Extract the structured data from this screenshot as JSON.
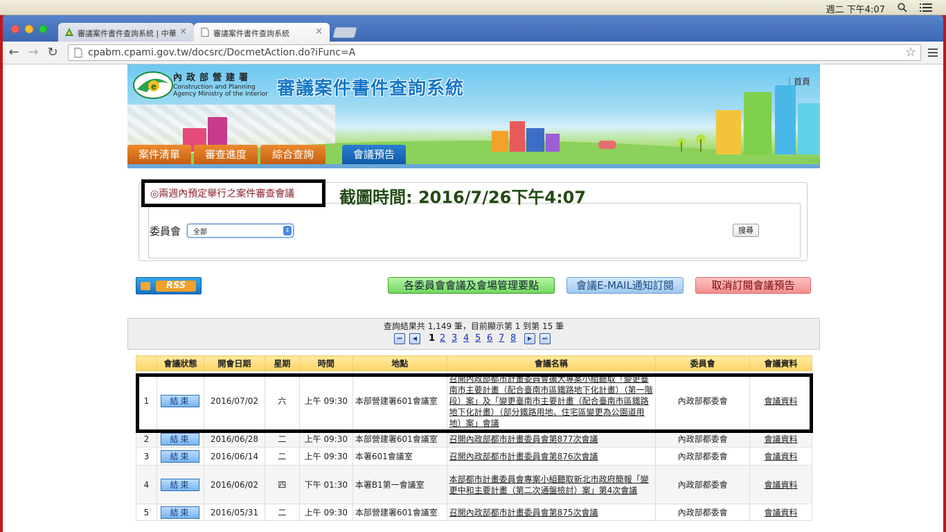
{
  "menubar": {
    "clock": "週二 下午4:07"
  },
  "browser": {
    "tabs": [
      {
        "title": "審議案件書件查詢系統 | 中華"
      },
      {
        "title": "審議案件書件查詢系統"
      }
    ],
    "url": "cpabm.cpami.gov.tw/docsrc/DocmetAction.do?iFunc=A",
    "accent": "#4d7ac3"
  },
  "site": {
    "agency_zh": "內政部營建署",
    "agency_en1": "Construction and Planning",
    "agency_en2": "Agency Ministry of the Interior",
    "system_title": "審議案件書件查詢系統",
    "home_link": "｜首頁",
    "nav": [
      "案件清單",
      "審查進度",
      "綜合查詢",
      "會議預告"
    ]
  },
  "notice": {
    "heading": "◎兩週內預定舉行之案件審查會議",
    "capture_time": "截圖時間: 2016/7/26下午4:07"
  },
  "filter": {
    "label": "委員會",
    "selected": "全部",
    "search_button": "搜尋"
  },
  "actions": {
    "rss": "RSS",
    "rules": "各委員會會議及會場管理要點",
    "subscribe": "會議E-MAIL通知訂閱",
    "unsubscribe": "取消訂閱會議預告"
  },
  "results": {
    "summary": "查詢結果共 1,149 筆，目前顯示第 1 到第 15 筆",
    "pages": [
      "1",
      "2",
      "3",
      "4",
      "5",
      "6",
      "7",
      "8"
    ],
    "current_page": "1"
  },
  "table": {
    "headers": [
      "",
      "會議狀態",
      "開會日期",
      "星期",
      "時間",
      "地點",
      "會議名稱",
      "委員會",
      "會議資料"
    ],
    "rows": [
      {
        "no": "1",
        "status": "結束",
        "date": "2016/07/02",
        "weekday": "六",
        "time": "上午 09:30",
        "place": "本部營建署601會議室",
        "name": "召開內政部都市計畫委員會擴大專案小組聽取「變更臺南市主要計畫（配合臺南市區鐵路地下化計畫）（第一階段）案」及「變更臺南市主要計畫（配合臺南市區鐵路地下化計畫）（部分鐵路用地、住宅區變更為公園道用地）案」會議",
        "committee": "內政部都委會",
        "docs": "會議資料"
      },
      {
        "no": "2",
        "status": "結束",
        "date": "2016/06/28",
        "weekday": "二",
        "time": "上午 09:30",
        "place": "本部營建署601會議室",
        "name": "召開內政部都市計畫委員會第877次會議",
        "committee": "內政部都委會",
        "docs": "會議資料"
      },
      {
        "no": "3",
        "status": "結束",
        "date": "2016/06/14",
        "weekday": "二",
        "time": "上午 09:30",
        "place": "本署601會議室",
        "name": "召開內政部都市計畫委員會第876次會議",
        "committee": "內政部都委會",
        "docs": "會議資料"
      },
      {
        "no": "4",
        "status": "結束",
        "date": "2016/06/02",
        "weekday": "四",
        "time": "下午 01:30",
        "place": "本署B1第一會議室",
        "name": "本部都市計畫委員會專案小組聽取新北市政府簡報「變更中和主要計畫（第二次通盤檢討）案」第4次會議",
        "committee": "內政部都委會",
        "docs": "會議資料"
      },
      {
        "no": "5",
        "status": "結束",
        "date": "2016/05/31",
        "weekday": "二",
        "time": "上午 09:30",
        "place": "本部營建署601會議室",
        "name": "召開內政部都市計畫委員會第875次會議",
        "committee": "內政部都委會",
        "docs": "會議資料"
      }
    ]
  }
}
